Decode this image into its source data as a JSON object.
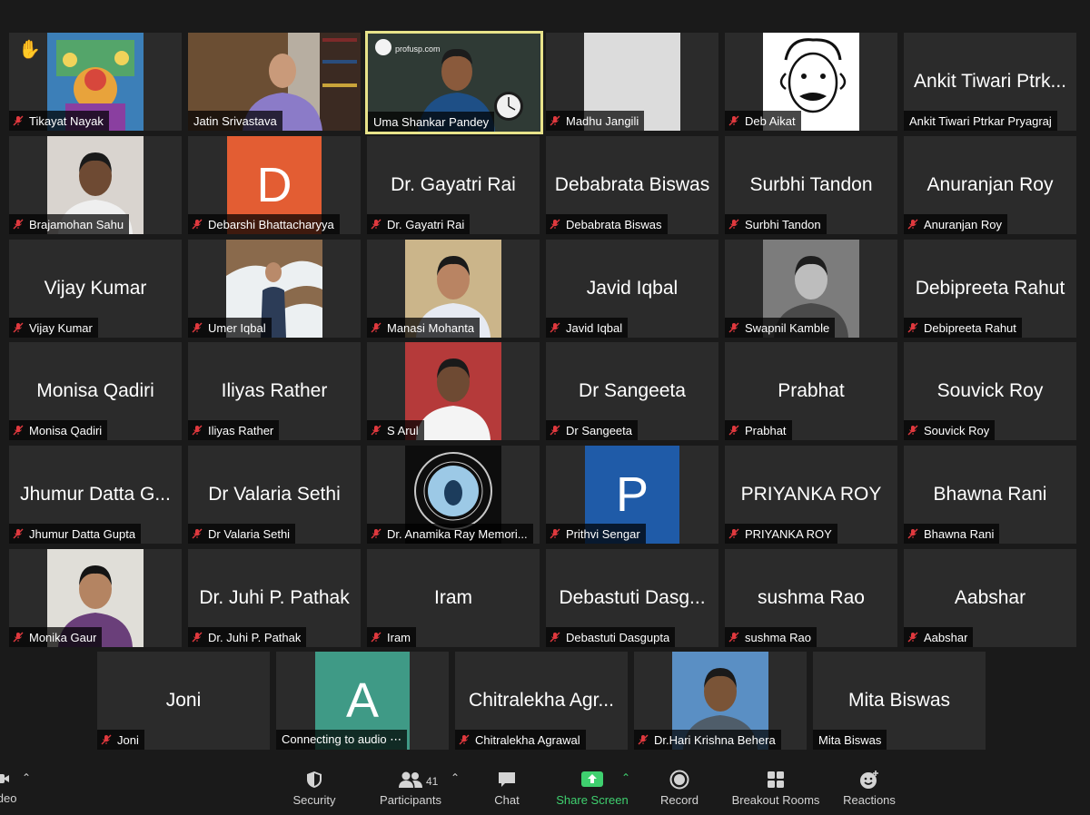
{
  "participants": [
    {
      "display": "photo",
      "name": "Tikayat Nayak",
      "muted": true,
      "hand_raised": true,
      "photo_kind": "colorful-art"
    },
    {
      "display": "photo",
      "name": "Jatin Srivastava",
      "muted": false,
      "photo_kind": "room-wide"
    },
    {
      "display": "photo",
      "name": "Uma Shankar Pandey",
      "muted": false,
      "speaking": true,
      "photo_kind": "board-wide",
      "board_text": "profusp.com"
    },
    {
      "display": "photo",
      "name": "Madhu Jangili",
      "muted": true,
      "photo_kind": "blank"
    },
    {
      "display": "photo",
      "name": "Deb Aikat",
      "muted": true,
      "photo_kind": "caricature"
    },
    {
      "display": "name",
      "name": "Ankit Tiwari Ptrkar Pryagraj",
      "big": "Ankit Tiwari Ptrk...",
      "muted": false
    },
    {
      "display": "photo",
      "name": "Brajamohan Sahu",
      "muted": true,
      "photo_kind": "portrait"
    },
    {
      "display": "letter",
      "name": "Debarshi Bhattacharyya",
      "letter": "D",
      "color": "#e35d33",
      "muted": true
    },
    {
      "display": "name",
      "name": "Dr. Gayatri Rai",
      "big": "Dr. Gayatri Rai",
      "muted": true
    },
    {
      "display": "name",
      "name": "Debabrata Biswas",
      "big": "Debabrata Biswas",
      "muted": true
    },
    {
      "display": "name",
      "name": "Surbhi Tandon",
      "big": "Surbhi Tandon",
      "muted": true
    },
    {
      "display": "name",
      "name": "Anuranjan Roy",
      "big": "Anuranjan Roy",
      "muted": true
    },
    {
      "display": "name",
      "name": "Vijay Kumar",
      "big": "Vijay Kumar",
      "muted": true
    },
    {
      "display": "photo",
      "name": "Umer Iqbal",
      "muted": true,
      "photo_kind": "snow"
    },
    {
      "display": "photo",
      "name": "Manasi Mohanta",
      "muted": true,
      "photo_kind": "portrait-saree"
    },
    {
      "display": "name",
      "name": "Javid Iqbal",
      "big": "Javid Iqbal",
      "muted": true
    },
    {
      "display": "photo",
      "name": "Swapnil Kamble",
      "muted": true,
      "photo_kind": "bw-portrait"
    },
    {
      "display": "name",
      "name": "Debipreeta Rahut",
      "big": "Debipreeta Rahut",
      "muted": true
    },
    {
      "display": "name",
      "name": "Monisa Qadiri",
      "big": "Monisa Qadiri",
      "muted": true
    },
    {
      "display": "name",
      "name": "Iliyas Rather",
      "big": "Iliyas Rather",
      "muted": true
    },
    {
      "display": "photo",
      "name": "S Arul",
      "muted": true,
      "photo_kind": "portrait-red"
    },
    {
      "display": "name",
      "name": "Dr Sangeeta",
      "big": "Dr Sangeeta",
      "muted": true
    },
    {
      "display": "name",
      "name": "Prabhat",
      "big": "Prabhat",
      "muted": true
    },
    {
      "display": "name",
      "name": "Souvick Roy",
      "big": "Souvick Roy",
      "muted": true
    },
    {
      "display": "name",
      "name": "Jhumur Datta Gupta",
      "big": "Jhumur Datta G...",
      "muted": true
    },
    {
      "display": "name",
      "name": "Dr Valaria Sethi",
      "big": "Dr Valaria Sethi",
      "muted": true
    },
    {
      "display": "photo",
      "name": "Dr. Anamika Ray Memori...",
      "muted": true,
      "photo_kind": "logo-seal"
    },
    {
      "display": "letter",
      "name": "Prithvi Sengar",
      "letter": "P",
      "color": "#1f5ba8",
      "muted": true
    },
    {
      "display": "name",
      "name": "PRIYANKA ROY",
      "big": "PRIYANKA ROY",
      "muted": true
    },
    {
      "display": "name",
      "name": "Bhawna Rani",
      "big": "Bhawna Rani",
      "muted": true
    },
    {
      "display": "photo",
      "name": "Monika Gaur",
      "muted": true,
      "photo_kind": "portrait-woman"
    },
    {
      "display": "name",
      "name": "Dr. Juhi P. Pathak",
      "big": "Dr. Juhi P. Pathak",
      "muted": true
    },
    {
      "display": "name",
      "name": "Iram",
      "big": "Iram",
      "muted": true
    },
    {
      "display": "name",
      "name": "Debastuti Dasgupta",
      "big": "Debastuti Dasg...",
      "muted": true
    },
    {
      "display": "name",
      "name": "sushma Rao",
      "big": "sushma Rao",
      "muted": true
    },
    {
      "display": "name",
      "name": "Aabshar",
      "big": "Aabshar",
      "muted": true
    },
    {
      "display": "name",
      "name": "Joni",
      "big": "Joni",
      "muted": true
    },
    {
      "display": "letter",
      "name": "Connecting to audio",
      "letter": "A",
      "color": "#3f9a86",
      "muted": false,
      "connecting": true
    },
    {
      "display": "name",
      "name": "Chitralekha Agrawal",
      "big": "Chitralekha Agr...",
      "muted": true
    },
    {
      "display": "photo",
      "name": "Dr.Hari Krishna Behera",
      "muted": true,
      "photo_kind": "portrait-blue"
    },
    {
      "display": "name",
      "name": "Mita Biswas",
      "big": "Mita Biswas",
      "muted": false
    }
  ],
  "toolbar": {
    "video_label": "Video",
    "security_label": "Security",
    "participants_label": "Participants",
    "participants_count": "41",
    "chat_label": "Chat",
    "share_label": "Share Screen",
    "record_label": "Record",
    "breakout_label": "Breakout Rooms",
    "reactions_label": "Reactions"
  },
  "colors": {
    "background": "#1a1a1a",
    "tile": "#2b2b2b",
    "speaker_border": "#e8e38a",
    "share_green": "#3fd06f",
    "mute_red": "#e0393e"
  }
}
